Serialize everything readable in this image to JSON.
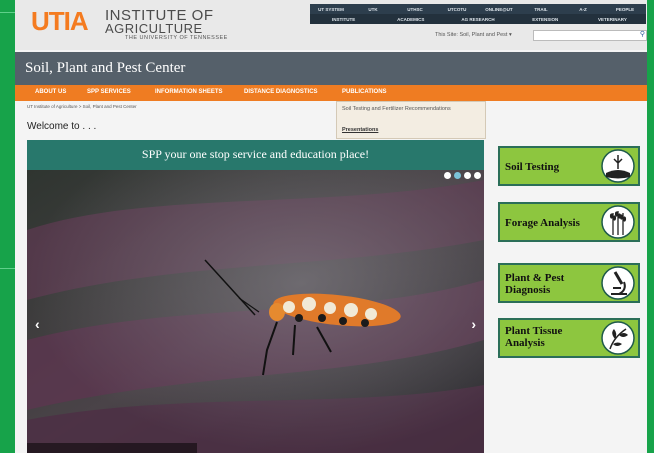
{
  "header": {
    "logo_mark": "UTIA",
    "logo_line1": "INSTITUTE OF",
    "logo_line2": "AGRICULTURE",
    "logo_line3": "THE UNIVERSITY OF TENNESSEE",
    "top_links_row1": [
      "UT SYSTEM",
      "UTK",
      "UTHSC",
      "UTCOTU",
      "ONLINE@UT",
      "TRAIL",
      "A-Z",
      "PEOPLE"
    ],
    "top_links_row2": [
      "INSTITUTE",
      "ACADEMICS",
      "AG RESEARCH",
      "EXTENSION",
      "VETERINARY"
    ],
    "site_search_label": "This Site: Soil, Plant and Pest ▾"
  },
  "banner": {
    "title": "Soil, Plant and Pest Center"
  },
  "nav": {
    "items": [
      "ABOUT US",
      "SPP SERVICES",
      "INFORMATION SHEETS",
      "DISTANCE DIAGNOSTICS",
      "PUBLICATIONS"
    ]
  },
  "breadcrumb": "UT Institute of Agriculture > Soil, Plant and Pest Center",
  "dropdown": {
    "item1": "Soil Testing and Fertilizer Recommendations",
    "item2": "Presentations"
  },
  "welcome": "Welcome to . . .",
  "slider": {
    "headline": "SPP your one stop service and education place!",
    "prev": "‹",
    "next": "›",
    "dots": 4,
    "active_dot": 1
  },
  "services": [
    {
      "label": "Soil Testing",
      "icon": "soil-icon"
    },
    {
      "label": "Forage Analysis",
      "icon": "wheat-icon"
    },
    {
      "label": "Plant & Pest Diagnosis",
      "label_l1": "Plant & Pest",
      "label_l2": "Diagnosis",
      "icon": "microscope-icon"
    },
    {
      "label": "Plant Tissue Analysis",
      "label_l1": "Plant Tissue",
      "label_l2": "Analysis",
      "icon": "leaf-icon"
    }
  ],
  "colors": {
    "accent_orange": "#ef7c22",
    "service_green": "#8dc63f",
    "banner_teal": "#28786c",
    "background_green": "#17a34a"
  }
}
